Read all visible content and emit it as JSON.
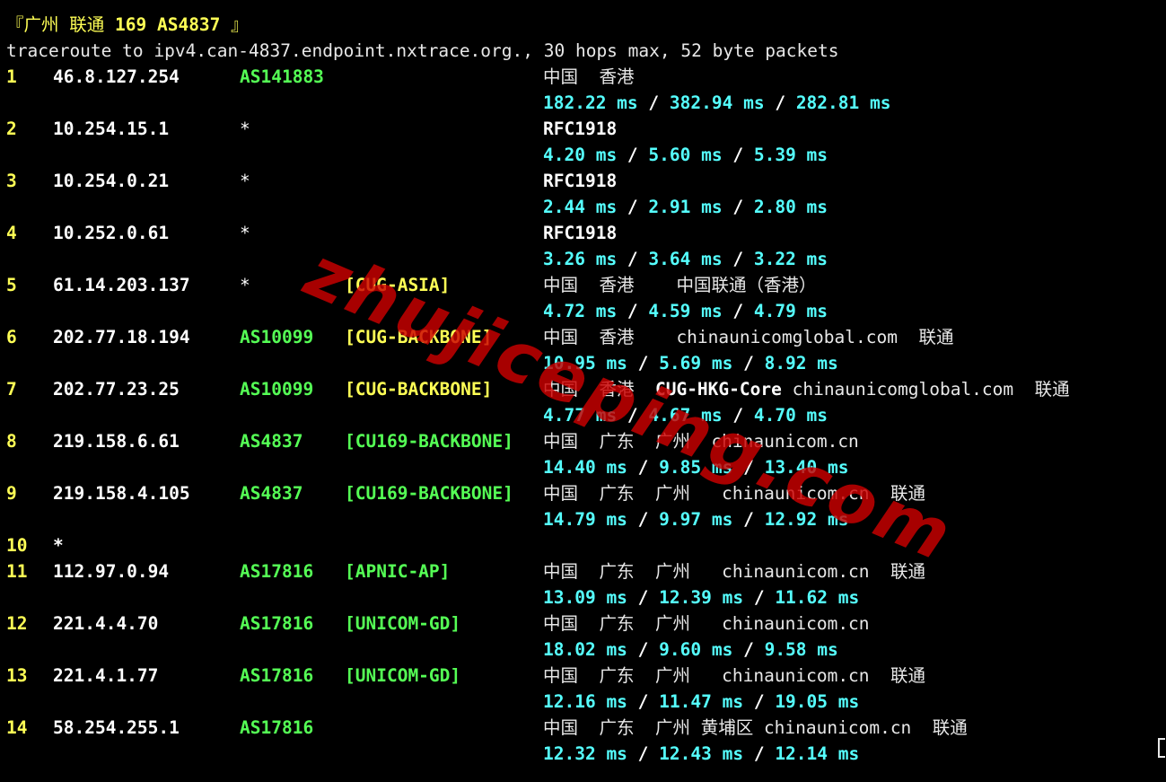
{
  "header": {
    "open_bracket": "『",
    "region": "广州 联通",
    "route_tag": "169 AS4837",
    "close_bracket": "』"
  },
  "command": "traceroute to ipv4.can-4837.endpoint.nxtrace.org., 30 hops max, 52 byte packets",
  "colors": {
    "background": "#000000",
    "hop_number": "#ffff55",
    "asn": "#55ff55",
    "rtt": "#55ffff",
    "watermark": "#cc0000"
  },
  "hops": [
    {
      "num": "1",
      "ip": "46.8.127.254",
      "asn": "AS141883",
      "tag": "",
      "geo": "中国  香港",
      "host_bold": "",
      "rtt": [
        "182.22 ms",
        "382.94 ms",
        "282.81 ms"
      ]
    },
    {
      "num": "2",
      "ip": "10.254.15.1",
      "asn": "*",
      "tag": "",
      "geo": "RFC1918",
      "host_bold": "",
      "rtt": [
        "4.20 ms",
        "5.60 ms",
        "5.39 ms"
      ]
    },
    {
      "num": "3",
      "ip": "10.254.0.21",
      "asn": "*",
      "tag": "",
      "geo": "RFC1918",
      "host_bold": "",
      "rtt": [
        "2.44 ms",
        "2.91 ms",
        "2.80 ms"
      ]
    },
    {
      "num": "4",
      "ip": "10.252.0.61",
      "asn": "*",
      "tag": "",
      "geo": "RFC1918",
      "host_bold": "",
      "rtt": [
        "3.26 ms",
        "3.64 ms",
        "3.22 ms"
      ]
    },
    {
      "num": "5",
      "ip": "61.14.203.137",
      "asn": "*",
      "tag": "[CUG-ASIA]",
      "geo": "中国  香港    中国联通（香港）",
      "host_bold": "",
      "rtt": [
        "4.72 ms",
        "4.59 ms",
        "4.79 ms"
      ]
    },
    {
      "num": "6",
      "ip": "202.77.18.194",
      "asn": "AS10099",
      "tag": "[CUG-BACKBONE]",
      "geo": "中国  香港    chinaunicomglobal.com  联通",
      "host_bold": "",
      "rtt": [
        "10.95 ms",
        "5.69 ms",
        "8.92 ms"
      ]
    },
    {
      "num": "7",
      "ip": "202.77.23.25",
      "asn": "AS10099",
      "tag": "[CUG-BACKBONE]",
      "geo_pre": "中国  香港  ",
      "host_bold": "CUG-HKG-Core",
      "geo_post": " chinaunicomglobal.com  联通",
      "rtt": [
        "4.77 ms",
        "4.67 ms",
        "4.70 ms"
      ]
    },
    {
      "num": "8",
      "ip": "219.158.6.61",
      "asn": "AS4837",
      "tag": "[CU169-BACKBONE]",
      "geo": "中国  广东  广州  chinaunicom.cn",
      "host_bold": "",
      "rtt": [
        "14.40 ms",
        "9.85 ms",
        "13.40 ms"
      ]
    },
    {
      "num": "9",
      "ip": "219.158.4.105",
      "asn": "AS4837",
      "tag": "[CU169-BACKBONE]",
      "geo": "中国  广东  广州   chinaunicom.cn  联通",
      "host_bold": "",
      "rtt": [
        "14.79 ms",
        "9.97 ms",
        "12.92 ms"
      ]
    },
    {
      "num": "10",
      "ip": "*"
    },
    {
      "num": "11",
      "ip": "112.97.0.94",
      "asn": "AS17816",
      "tag": "[APNIC-AP]",
      "geo": "中国  广东  广州   chinaunicom.cn  联通",
      "host_bold": "",
      "rtt": [
        "13.09 ms",
        "12.39 ms",
        "11.62 ms"
      ]
    },
    {
      "num": "12",
      "ip": "221.4.4.70",
      "asn": "AS17816",
      "tag": "[UNICOM-GD]",
      "geo": "中国  广东  广州   chinaunicom.cn",
      "host_bold": "",
      "rtt": [
        "18.02 ms",
        "9.60 ms",
        "9.58 ms"
      ]
    },
    {
      "num": "13",
      "ip": "221.4.1.77",
      "asn": "AS17816",
      "tag": "[UNICOM-GD]",
      "geo": "中国  广东  广州   chinaunicom.cn  联通",
      "host_bold": "",
      "rtt": [
        "12.16 ms",
        "11.47 ms",
        "19.05 ms"
      ]
    },
    {
      "num": "14",
      "ip": "58.254.255.1",
      "asn": "AS17816",
      "tag": "",
      "geo": "中国  广东  广州 黄埔区 chinaunicom.cn  联通",
      "host_bold": "",
      "rtt": [
        "12.32 ms",
        "12.43 ms",
        "12.14 ms"
      ]
    }
  ],
  "rtt_separator": " / ",
  "watermark": "zhujiceping.com"
}
